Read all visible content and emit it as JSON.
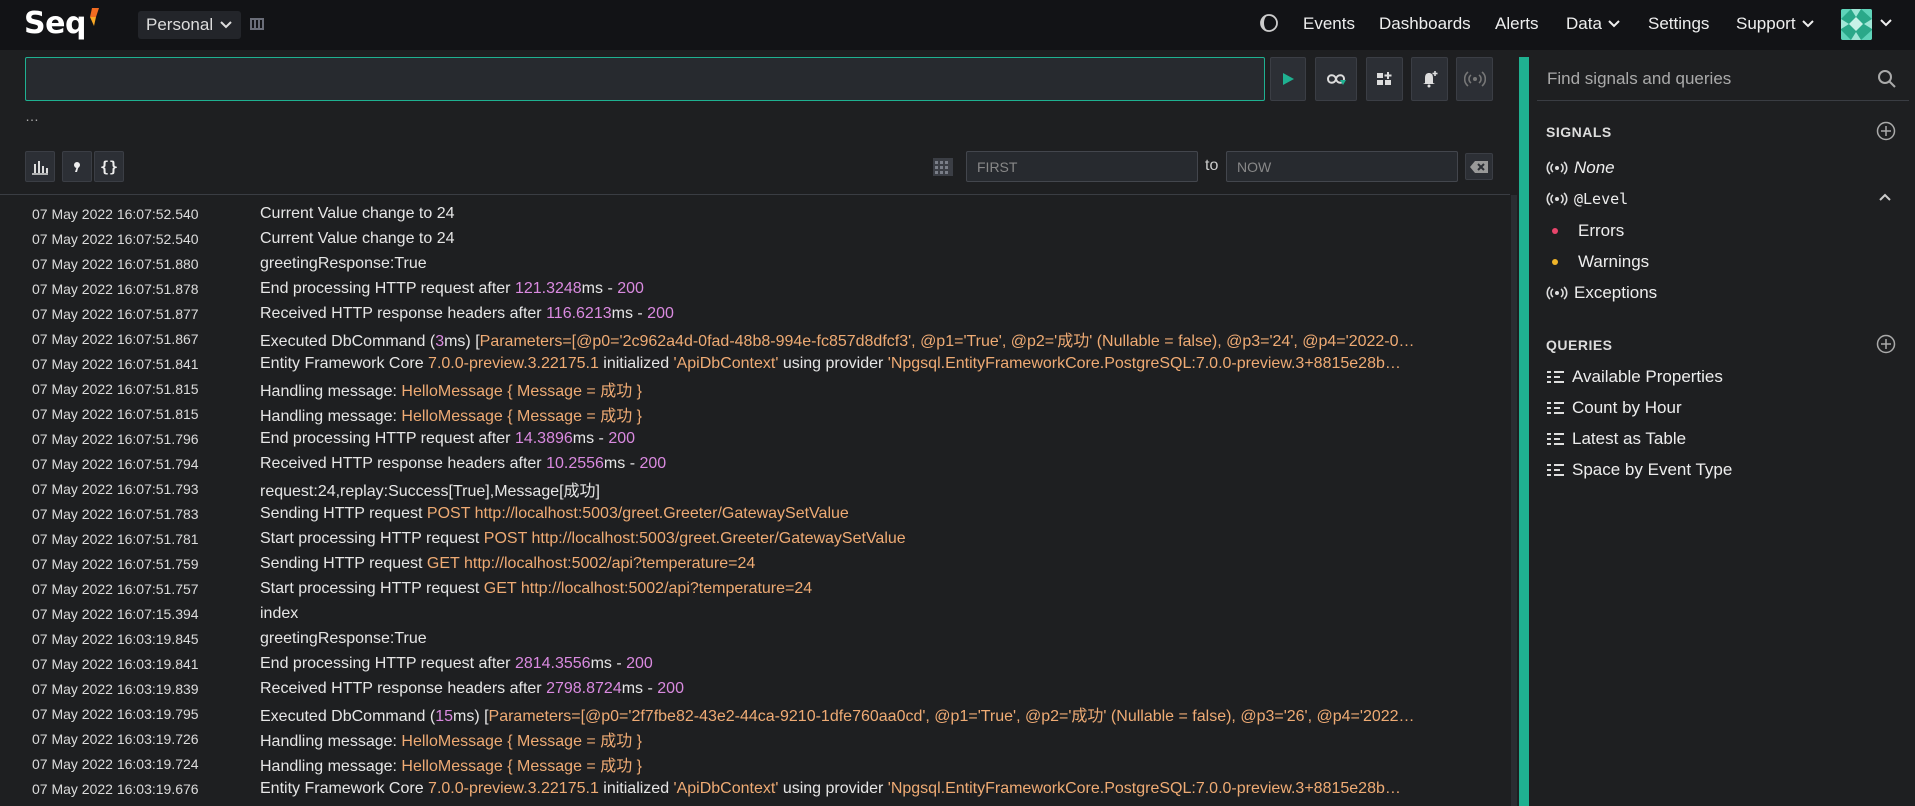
{
  "app": {
    "logo": "Seq",
    "workspace": "Personal"
  },
  "nav": {
    "events": "Events",
    "dashboards": "Dashboards",
    "alerts": "Alerts",
    "data": "Data",
    "settings": "Settings",
    "support": "Support"
  },
  "search": {
    "query_value": "",
    "ellipsis": "…"
  },
  "range": {
    "from_placeholder": "FIRST",
    "to_label": "to",
    "to_placeholder": "NOW"
  },
  "events": [
    {
      "ts": "07 May 2022  16:07:52.540",
      "parts": [
        {
          "t": "Current Value change to 24"
        }
      ]
    },
    {
      "ts": "07 May 2022  16:07:52.540",
      "parts": [
        {
          "t": "Current Value change to 24"
        }
      ]
    },
    {
      "ts": "07 May 2022  16:07:51.880",
      "parts": [
        {
          "t": "greetingResponse:True"
        }
      ]
    },
    {
      "ts": "07 May 2022  16:07:51.878",
      "parts": [
        {
          "t": "End processing HTTP request after "
        },
        {
          "t": "121.3248",
          "k": "num"
        },
        {
          "t": "ms - "
        },
        {
          "t": "200",
          "k": "num"
        }
      ]
    },
    {
      "ts": "07 May 2022  16:07:51.877",
      "parts": [
        {
          "t": "Received HTTP response headers after "
        },
        {
          "t": "116.6213",
          "k": "num"
        },
        {
          "t": "ms - "
        },
        {
          "t": "200",
          "k": "num"
        }
      ]
    },
    {
      "ts": "07 May 2022  16:07:51.867",
      "parts": [
        {
          "t": "Executed DbCommand ("
        },
        {
          "t": "3",
          "k": "num"
        },
        {
          "t": "ms) ["
        },
        {
          "t": "Parameters=[@p0='2c962a4d-0fad-48b8-994e-fc857d8dfcf3', @p1='True', @p2='成功' (Nullable = false), @p3='24', @p4='2022-0…",
          "k": "str"
        }
      ]
    },
    {
      "ts": "07 May 2022  16:07:51.841",
      "parts": [
        {
          "t": "Entity Framework Core "
        },
        {
          "t": "7.0.0-preview.3.22175.1",
          "k": "str"
        },
        {
          "t": " initialized "
        },
        {
          "t": "'ApiDbContext'",
          "k": "str"
        },
        {
          "t": " using provider "
        },
        {
          "t": "'Npgsql.EntityFrameworkCore.PostgreSQL:7.0.0-preview.3+8815e28b…",
          "k": "str"
        }
      ]
    },
    {
      "ts": "07 May 2022  16:07:51.815",
      "parts": [
        {
          "t": "Handling message: "
        },
        {
          "t": "HelloMessage { Message = 成功 }",
          "k": "str"
        }
      ]
    },
    {
      "ts": "07 May 2022  16:07:51.815",
      "parts": [
        {
          "t": "Handling message: "
        },
        {
          "t": "HelloMessage { Message = 成功 }",
          "k": "str"
        }
      ]
    },
    {
      "ts": "07 May 2022  16:07:51.796",
      "parts": [
        {
          "t": "End processing HTTP request after "
        },
        {
          "t": "14.3896",
          "k": "num"
        },
        {
          "t": "ms - "
        },
        {
          "t": "200",
          "k": "num"
        }
      ]
    },
    {
      "ts": "07 May 2022  16:07:51.794",
      "parts": [
        {
          "t": "Received HTTP response headers after "
        },
        {
          "t": "10.2556",
          "k": "num"
        },
        {
          "t": "ms - "
        },
        {
          "t": "200",
          "k": "num"
        }
      ]
    },
    {
      "ts": "07 May 2022  16:07:51.793",
      "parts": [
        {
          "t": "request:24,replay:Success[True],Message[成功]"
        }
      ]
    },
    {
      "ts": "07 May 2022  16:07:51.783",
      "parts": [
        {
          "t": "Sending HTTP request "
        },
        {
          "t": "POST",
          "k": "str"
        },
        {
          "t": " "
        },
        {
          "t": "http://localhost:5003/greet.Greeter/GatewaySetValue",
          "k": "str"
        }
      ]
    },
    {
      "ts": "07 May 2022  16:07:51.781",
      "parts": [
        {
          "t": "Start processing HTTP request "
        },
        {
          "t": "POST",
          "k": "str"
        },
        {
          "t": " "
        },
        {
          "t": "http://localhost:5003/greet.Greeter/GatewaySetValue",
          "k": "str"
        }
      ]
    },
    {
      "ts": "07 May 2022  16:07:51.759",
      "parts": [
        {
          "t": "Sending HTTP request "
        },
        {
          "t": "GET",
          "k": "str"
        },
        {
          "t": " "
        },
        {
          "t": "http://localhost:5002/api?temperature=24",
          "k": "str"
        }
      ]
    },
    {
      "ts": "07 May 2022  16:07:51.757",
      "parts": [
        {
          "t": "Start processing HTTP request "
        },
        {
          "t": "GET",
          "k": "str"
        },
        {
          "t": " "
        },
        {
          "t": "http://localhost:5002/api?temperature=24",
          "k": "str"
        }
      ]
    },
    {
      "ts": "07 May 2022  16:07:15.394",
      "parts": [
        {
          "t": "index"
        }
      ]
    },
    {
      "ts": "07 May 2022  16:03:19.845",
      "parts": [
        {
          "t": "greetingResponse:True"
        }
      ]
    },
    {
      "ts": "07 May 2022  16:03:19.841",
      "parts": [
        {
          "t": "End processing HTTP request after "
        },
        {
          "t": "2814.3556",
          "k": "num"
        },
        {
          "t": "ms - "
        },
        {
          "t": "200",
          "k": "num"
        }
      ]
    },
    {
      "ts": "07 May 2022  16:03:19.839",
      "parts": [
        {
          "t": "Received HTTP response headers after "
        },
        {
          "t": "2798.8724",
          "k": "num"
        },
        {
          "t": "ms - "
        },
        {
          "t": "200",
          "k": "num"
        }
      ]
    },
    {
      "ts": "07 May 2022  16:03:19.795",
      "parts": [
        {
          "t": "Executed DbCommand ("
        },
        {
          "t": "15",
          "k": "num"
        },
        {
          "t": "ms) ["
        },
        {
          "t": "Parameters=[@p0='2f7fbe82-43e2-44ca-9210-1dfe760aa0cd', @p1='True', @p2='成功' (Nullable = false), @p3='26', @p4='2022…",
          "k": "str"
        }
      ]
    },
    {
      "ts": "07 May 2022  16:03:19.726",
      "parts": [
        {
          "t": "Handling message: "
        },
        {
          "t": "HelloMessage { Message = 成功 }",
          "k": "str"
        }
      ]
    },
    {
      "ts": "07 May 2022  16:03:19.724",
      "parts": [
        {
          "t": "Handling message: "
        },
        {
          "t": "HelloMessage { Message = 成功 }",
          "k": "str"
        }
      ]
    },
    {
      "ts": "07 May 2022  16:03:19.676",
      "parts": [
        {
          "t": "Entity Framework Core "
        },
        {
          "t": "7.0.0-preview.3.22175.1",
          "k": "str"
        },
        {
          "t": " initialized "
        },
        {
          "t": "'ApiDbContext'",
          "k": "str"
        },
        {
          "t": " using provider "
        },
        {
          "t": "'Npgsql.EntityFrameworkCore.PostgreSQL:7.0.0-preview.3+8815e28b…",
          "k": "str"
        }
      ]
    }
  ],
  "sidebar": {
    "find_placeholder": "Find signals and queries",
    "signals_title": "SIGNALS",
    "signals": [
      {
        "label": "None",
        "kind": "signal"
      },
      {
        "label": "@Level",
        "kind": "signal"
      },
      {
        "label": "Errors",
        "kind": "bullet",
        "color": "#e8456b"
      },
      {
        "label": "Warnings",
        "kind": "bullet",
        "color": "#f0b429"
      },
      {
        "label": "Exceptions",
        "kind": "signal"
      }
    ],
    "queries_title": "QUERIES",
    "queries": [
      "Available Properties",
      "Count by Hour",
      "Latest as Table",
      "Space by Event Type"
    ]
  },
  "colors": {
    "accent": "#1fb191",
    "number": "#da8ae0",
    "string": "#efab74"
  }
}
